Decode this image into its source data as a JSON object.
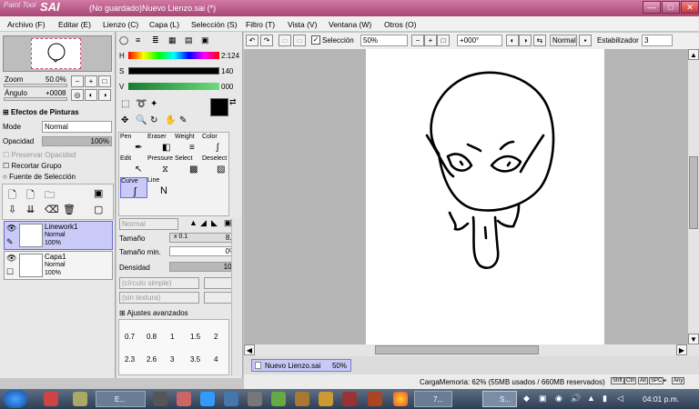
{
  "app": {
    "logo_small": "Paint Tool",
    "logo_big": "SAI",
    "title": "(No guardado)Nuevo Lienzo.sai (*)"
  },
  "window_buttons": {
    "minimize": "—",
    "maximize": "□",
    "close": "✕"
  },
  "menu": [
    "Archivo (F)",
    "Editar (E)",
    "Lienzo (C)",
    "Capa (L)",
    "Selección (S)",
    "Filtro (T)",
    "Vista (V)",
    "Ventana (W)",
    "Otros (O)"
  ],
  "toolbar": {
    "selection_label": "Selección",
    "zoom_value": "50%",
    "angle_value": "+000°",
    "blend_mode": "Normal",
    "stabilizer_label": "Estabilizador",
    "stabilizer_value": "3"
  },
  "navigator": {
    "zoom_label": "Zoom",
    "zoom_value": "50.0%",
    "angle_label": "Ángulo",
    "angle_value": "+0008"
  },
  "paint_effects": {
    "header": "Efectos de Pinturas",
    "mode_label": "Mode",
    "mode_value": "Normal",
    "opacity_label": "Opacidad",
    "opacity_value": "100%",
    "opacity_level": 1.0,
    "preserve_opacity": "Preservar Opacidad",
    "clip_group": "Recortar Grupo",
    "selection_source": "Fuente de Selección"
  },
  "layers": [
    {
      "name": "Linework1",
      "mode": "Normal",
      "opacity": "100%",
      "selected": true
    },
    {
      "name": "Capa1",
      "mode": "Normal",
      "opacity": "100%",
      "selected": false
    }
  ],
  "color": {
    "h_label": "H",
    "h_value": "2:124",
    "s_label": "S",
    "s_value": "140",
    "v_label": "V",
    "v_value": "000",
    "primary": "#000000",
    "secondary": "#c0c0c0"
  },
  "brush_tools": [
    [
      "Pen",
      "Eraser",
      "Weight",
      "Color"
    ],
    [
      "Edit",
      "Pressure",
      "Select",
      "Deselect"
    ],
    [
      "Curve",
      "Line",
      "",
      ""
    ]
  ],
  "brush_settings": {
    "mode_value": "Normal",
    "size_label": "Tamaño",
    "size_mult": "x 0.1",
    "size_value": "8.7",
    "min_size_label": "Tamaño min.",
    "min_size_value": "0%",
    "density_label": "Densidad",
    "density_value": "100",
    "density_level": 1.0,
    "shape_value": "(círculo simple)",
    "shape_num": "0",
    "texture_value": "(sin textura)",
    "texture_num": "0",
    "advanced": "Ajustes avanzados"
  },
  "brush_sizes": [
    [
      "0.7",
      "0.8",
      "1",
      "1.5",
      "2"
    ],
    [
      "2.3",
      "2.6",
      "3",
      "3.5",
      "4"
    ]
  ],
  "document_tab": {
    "name": "Nuevo Lienzo.sai",
    "zoom": "50%"
  },
  "status": {
    "memory": "CargaMemoria: 62% (55MB usados / 660MB reservados)",
    "keys": [
      "Shft",
      "Ctrl",
      "Alt",
      "SPC",
      "⌖",
      "Any"
    ]
  },
  "taskbar": {
    "time": "04:01 p.m.",
    "item_e": "E...",
    "item_7": "7...",
    "item_s": "S..."
  },
  "colors": {
    "title": "#b04a7a",
    "accent": "#c7c8f4",
    "layer_select": "#c9caf7"
  }
}
